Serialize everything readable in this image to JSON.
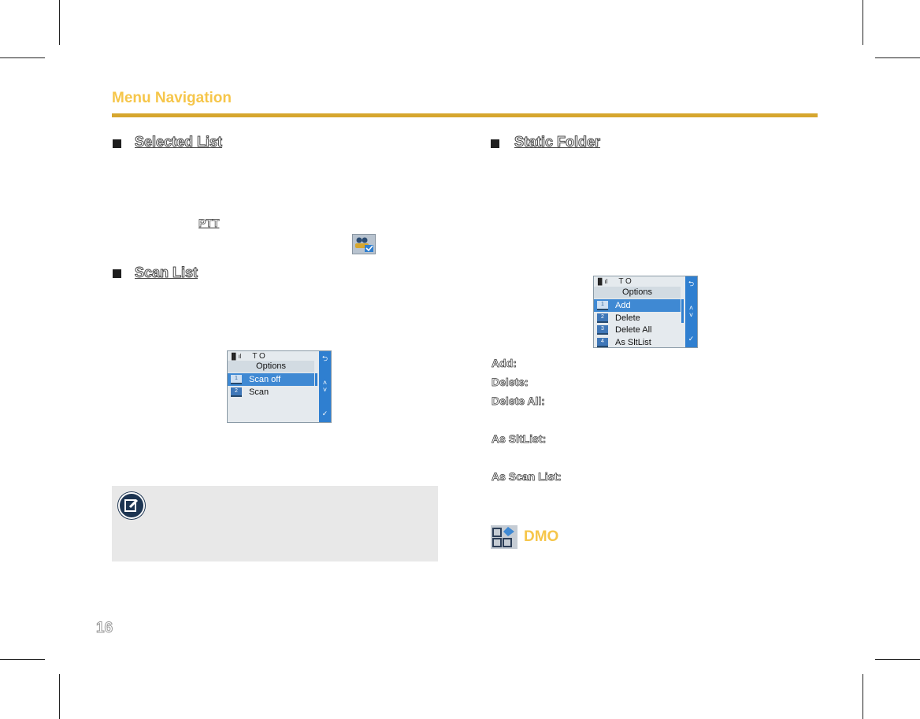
{
  "header": {
    "title": "Menu Navigation"
  },
  "left": {
    "selected_list_heading": "Selected List",
    "ptt_label": "PTT",
    "scan_list_heading": "Scan List",
    "scan_screen": {
      "status": "T O",
      "title": "Options",
      "items": [
        {
          "num": "1",
          "label": "Scan off"
        },
        {
          "num": "2",
          "label": "Scan"
        }
      ]
    }
  },
  "right": {
    "static_folder_heading": "Static Folder",
    "options_screen": {
      "status": "T O",
      "title": "Options",
      "items": [
        {
          "num": "1",
          "label": "Add"
        },
        {
          "num": "2",
          "label": "Delete"
        },
        {
          "num": "3",
          "label": "Delete All"
        },
        {
          "num": "4",
          "label": "As SltList"
        }
      ]
    },
    "defs": {
      "add": "Add:",
      "delete": "Delete:",
      "delete_all": "Delete All:",
      "as_sltlist": "As SltList:",
      "as_scan_list": "As Scan List:"
    },
    "dmo_title": "DMO"
  },
  "page_number": "16",
  "colors": {
    "accent": "#f6c64a",
    "rule": "#d6a62e",
    "highlight": "#3f89d3",
    "side_bar": "#2f7fd0"
  }
}
